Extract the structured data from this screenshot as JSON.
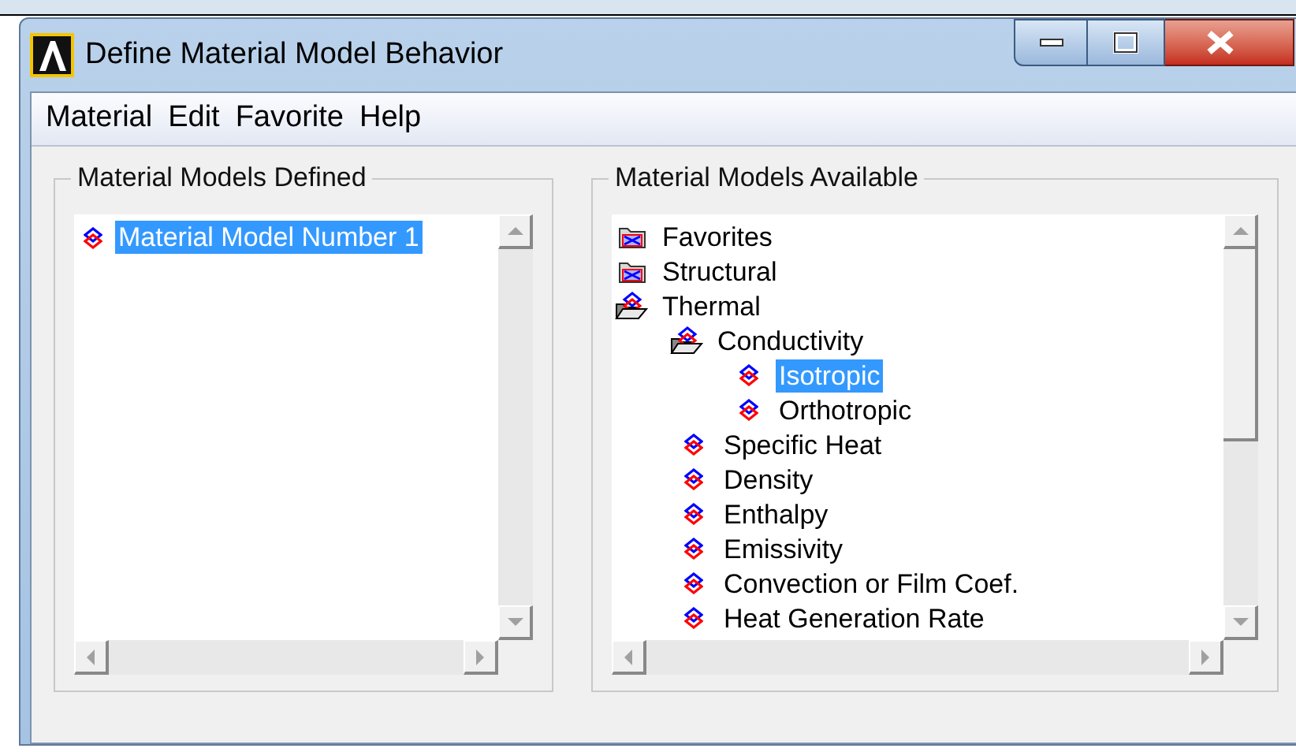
{
  "window": {
    "title": "Define Material Model Behavior"
  },
  "menu": [
    "Material",
    "Edit",
    "Favorite",
    "Help"
  ],
  "defined": {
    "title": "Material Models Defined",
    "items": [
      {
        "label": "Material Model Number 1",
        "selected": true
      }
    ]
  },
  "available": {
    "title": "Material Models Available",
    "tree": [
      {
        "label": "Favorites",
        "kind": "folder",
        "expanded": false,
        "selected": false
      },
      {
        "label": "Structural",
        "kind": "folder",
        "expanded": false,
        "selected": false
      },
      {
        "label": "Thermal",
        "kind": "folder",
        "expanded": true,
        "selected": false,
        "children": [
          {
            "label": "Conductivity",
            "kind": "folder",
            "expanded": true,
            "selected": false,
            "children": [
              {
                "label": "Isotropic",
                "kind": "model",
                "selected": true
              },
              {
                "label": "Orthotropic",
                "kind": "model",
                "selected": false
              }
            ]
          },
          {
            "label": "Specific Heat",
            "kind": "model",
            "selected": false
          },
          {
            "label": "Density",
            "kind": "model",
            "selected": false
          },
          {
            "label": "Enthalpy",
            "kind": "model",
            "selected": false
          },
          {
            "label": "Emissivity",
            "kind": "model",
            "selected": false
          },
          {
            "label": "Convection or Film Coef.",
            "kind": "model",
            "selected": false
          },
          {
            "label": "Heat Generation Rate",
            "kind": "model",
            "selected": false
          }
        ]
      }
    ]
  }
}
